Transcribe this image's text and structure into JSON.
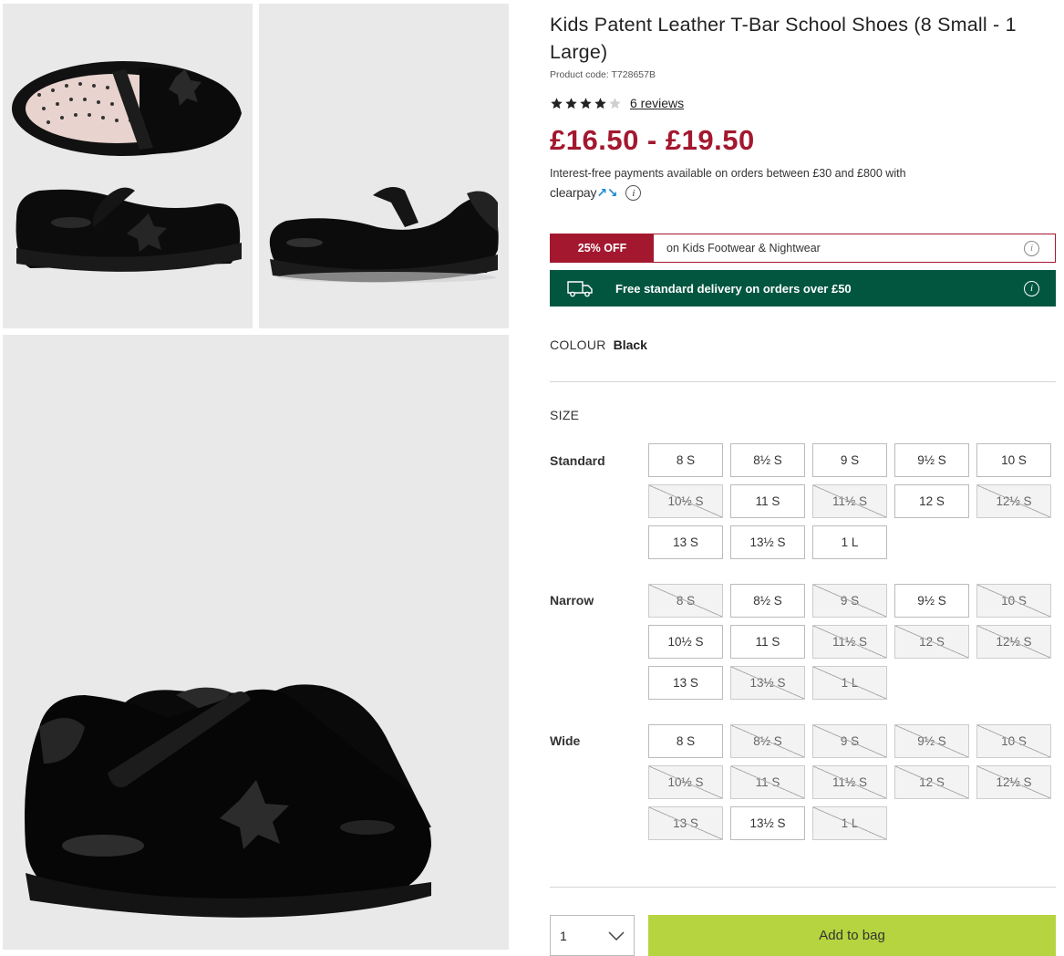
{
  "product": {
    "title": "Kids Patent Leather T-Bar School Shoes (8 Small - 1 Large)",
    "code": "Product code: T728657B",
    "rating": 4,
    "rating_max": 5,
    "reviews_label": "6 reviews",
    "price": "£16.50 - £19.50",
    "price_color": "#a3182f"
  },
  "clearpay": {
    "text": "Interest-free payments available on orders between £30 and £800 with",
    "logo": "clearpay",
    "logo_mark": "↗↘",
    "icon": "info-icon"
  },
  "promo": {
    "badge": "25% OFF",
    "text": "on Kids Footwear & Nightwear",
    "icon": "info-icon"
  },
  "delivery": {
    "text": "Free standard delivery on orders over £50",
    "icon": "delivery-van-icon",
    "color": "#025640"
  },
  "colour": {
    "label": "COLOUR",
    "value": "Black"
  },
  "size": {
    "label": "SIZE",
    "groups": [
      {
        "name": "Standard",
        "sizes": [
          {
            "label": "8 S",
            "available": true
          },
          {
            "label": "8½ S",
            "available": true
          },
          {
            "label": "9 S",
            "available": true
          },
          {
            "label": "9½ S",
            "available": true
          },
          {
            "label": "10 S",
            "available": true
          },
          {
            "label": "10½ S",
            "available": false
          },
          {
            "label": "11 S",
            "available": true
          },
          {
            "label": "11½ S",
            "available": false
          },
          {
            "label": "12 S",
            "available": true
          },
          {
            "label": "12½ S",
            "available": false
          },
          {
            "label": "13 S",
            "available": true
          },
          {
            "label": "13½ S",
            "available": true
          },
          {
            "label": "1 L",
            "available": true
          }
        ]
      },
      {
        "name": "Narrow",
        "sizes": [
          {
            "label": "8 S",
            "available": false
          },
          {
            "label": "8½ S",
            "available": true
          },
          {
            "label": "9 S",
            "available": false
          },
          {
            "label": "9½ S",
            "available": true
          },
          {
            "label": "10 S",
            "available": false
          },
          {
            "label": "10½ S",
            "available": true
          },
          {
            "label": "11 S",
            "available": true
          },
          {
            "label": "11½ S",
            "available": false
          },
          {
            "label": "12 S",
            "available": false
          },
          {
            "label": "12½ S",
            "available": false
          },
          {
            "label": "13 S",
            "available": true
          },
          {
            "label": "13½ S",
            "available": false
          },
          {
            "label": "1 L",
            "available": false
          }
        ]
      },
      {
        "name": "Wide",
        "sizes": [
          {
            "label": "8 S",
            "available": true
          },
          {
            "label": "8½ S",
            "available": false
          },
          {
            "label": "9 S",
            "available": false
          },
          {
            "label": "9½ S",
            "available": false
          },
          {
            "label": "10 S",
            "available": false
          },
          {
            "label": "10½ S",
            "available": false
          },
          {
            "label": "11 S",
            "available": false
          },
          {
            "label": "11½ S",
            "available": false
          },
          {
            "label": "12 S",
            "available": false
          },
          {
            "label": "12½ S",
            "available": false
          },
          {
            "label": "13 S",
            "available": false
          },
          {
            "label": "13½ S",
            "available": true
          },
          {
            "label": "1 L",
            "available": false
          }
        ]
      }
    ]
  },
  "purchase": {
    "quantity": "1",
    "add_label": "Add to bag",
    "add_color": "#b6d43f"
  },
  "images": [
    {
      "name": "product-image-top-and-side"
    },
    {
      "name": "product-image-side"
    },
    {
      "name": "product-image-main-pair"
    }
  ]
}
